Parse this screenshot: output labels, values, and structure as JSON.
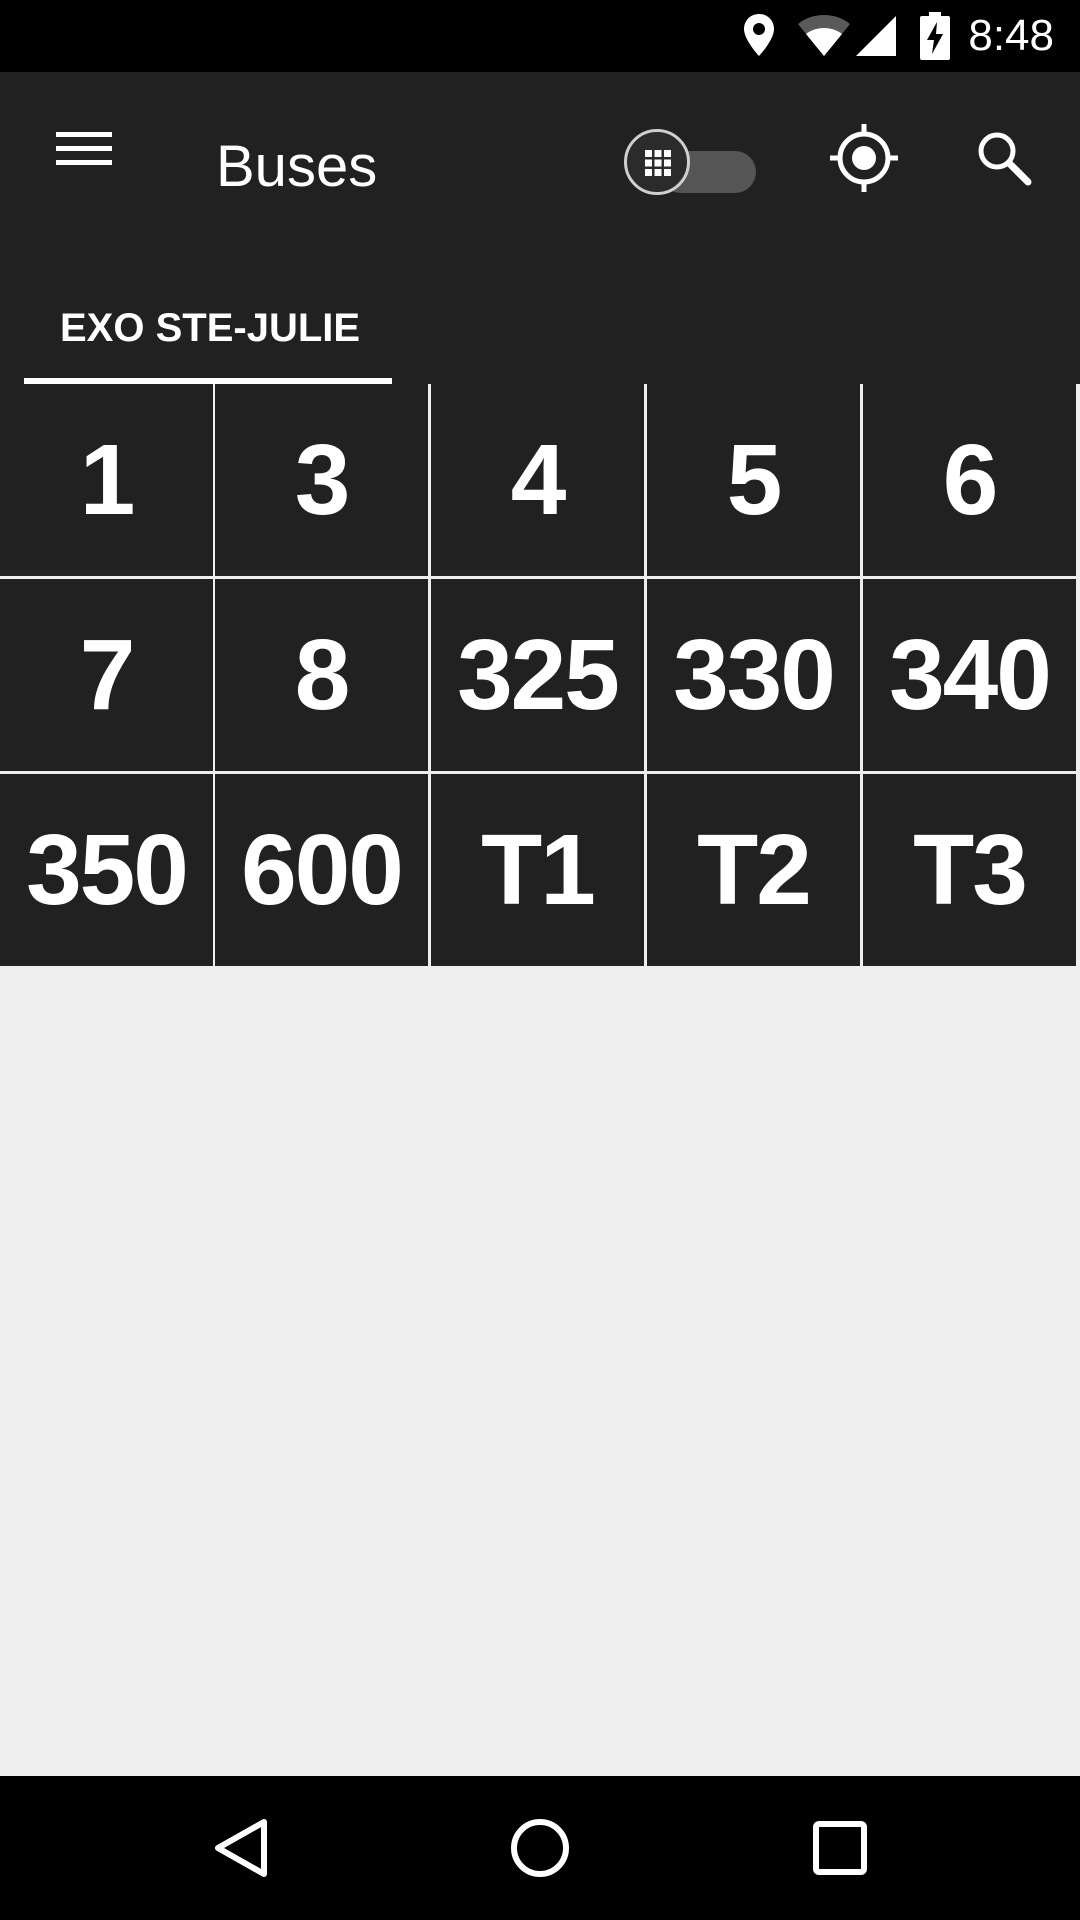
{
  "status_bar": {
    "time": "8:48",
    "icons": [
      "location-icon",
      "wifi-icon",
      "signal-icon",
      "battery-charging-icon"
    ]
  },
  "app_bar": {
    "title": "Buses",
    "menu_icon": "menu-icon",
    "toggle_icon": "grid-icon",
    "location_icon": "my-location-icon",
    "search_icon": "search-icon"
  },
  "tabs": [
    {
      "label": "EXO STE-JULIE",
      "selected": true
    }
  ],
  "routes": [
    "1",
    "3",
    "4",
    "5",
    "6",
    "7",
    "8",
    "325",
    "330",
    "340",
    "350",
    "600",
    "T1",
    "T2",
    "T3"
  ],
  "nav_bar": {
    "icons": [
      "back-icon",
      "home-icon",
      "recents-icon"
    ]
  },
  "colors": {
    "app_bar": "#212121",
    "status_bar": "#000000",
    "background": "#eeeeee",
    "cell": "#212121",
    "text": "#ffffff"
  }
}
